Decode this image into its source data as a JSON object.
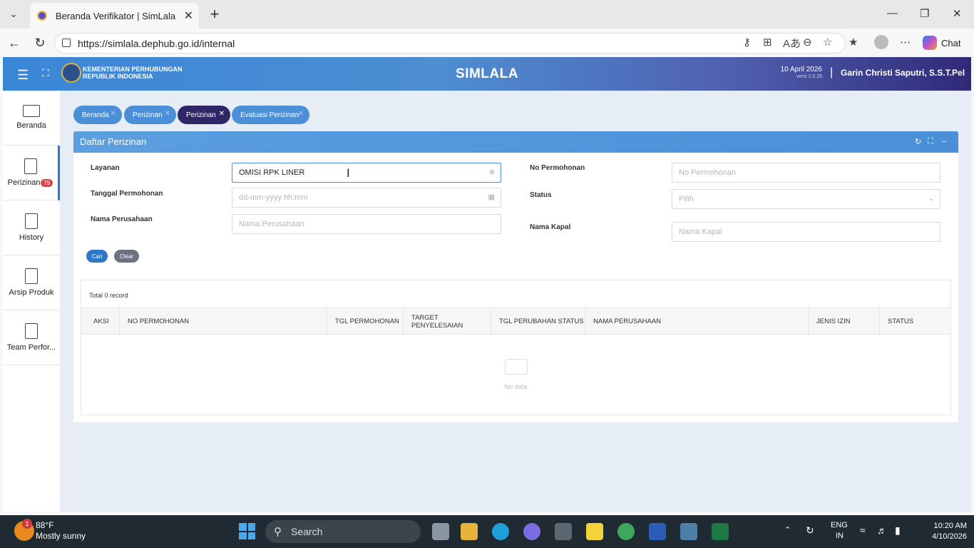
{
  "browser": {
    "tab_title": "Beranda Verifikator | SimLala",
    "url": "https://simlala.dephub.go.id/internal",
    "chat_label": "Chat"
  },
  "header": {
    "ministry_line1": "KEMENTERIAN PERHUBUNGAN",
    "ministry_line2": "REPUBLIK INDONESIA",
    "brand": "SIMLALA",
    "date": "10 April 2026",
    "version": "versi 2.0.25",
    "user": "Garin Christi Saputri, S.S.T.Pel"
  },
  "sidebar": {
    "items": [
      {
        "label": "Beranda"
      },
      {
        "label": "Perizinan",
        "badge": "79"
      },
      {
        "label": "History"
      },
      {
        "label": "Arsip Produk"
      },
      {
        "label": "Team Perfor..."
      }
    ]
  },
  "breadcrumbs": [
    "Beranda",
    "Perizinan",
    "Perizinan",
    "Evaluasi Perizinan"
  ],
  "panel": {
    "title": "Daftar Perizinan",
    "form": {
      "layanan_label": "Layanan",
      "layanan_value": "OMISI RPK LINER",
      "tanggal_label": "Tanggal Permohonan",
      "tanggal_placeholder": "dd-mm-yyyy hh:mm",
      "perusahaan_label": "Nama Perusahaan",
      "perusahaan_placeholder": "Nama Perusahaan",
      "nopermohonan_label": "No Permohonan",
      "nopermohonan_placeholder": "No Permohonan",
      "status_label": "Status",
      "status_placeholder": "Pilih",
      "kapal_label": "Nama Kapal",
      "kapal_placeholder": "Nama Kapal",
      "cari": "Cari",
      "clear": "Clear"
    },
    "table": {
      "total": "Total 0 record",
      "columns": [
        "AKSI",
        "NO PERMOHONAN",
        "TGL PERMOHONAN",
        "TARGET PENYELESAIAN",
        "TGL PERUBAHAN STATUS",
        "NAMA PERUSAHAAN",
        "JENIS IZIN",
        "STATUS"
      ],
      "empty": "No data"
    }
  },
  "taskbar": {
    "weather_badge": "1",
    "temp": "88°F",
    "condition": "Mostly sunny",
    "search": "Search",
    "lang1": "ENG",
    "lang2": "IN",
    "time": "10:20 AM",
    "date": "4/10/2026"
  }
}
